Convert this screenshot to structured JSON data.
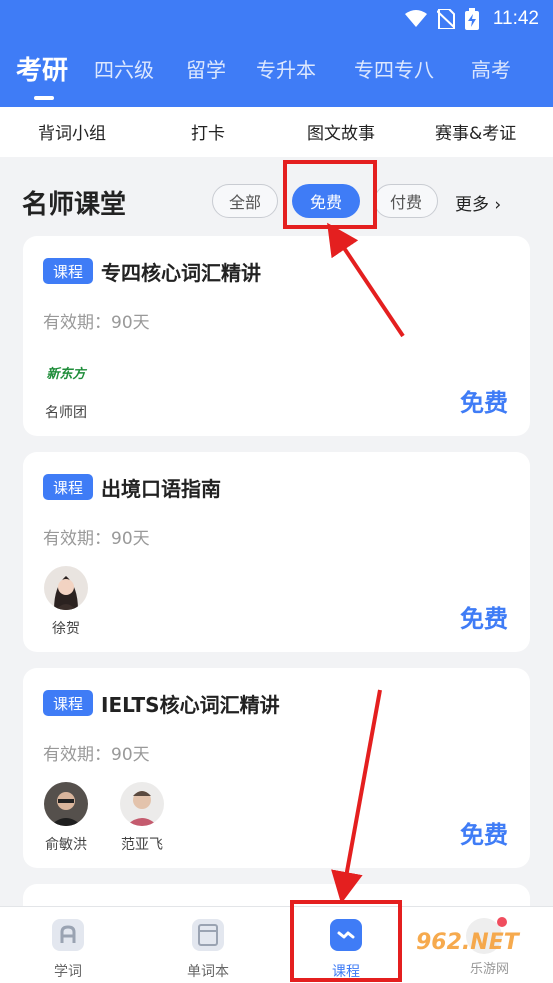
{
  "status_bar": {
    "time": "11:42",
    "icons": [
      "wifi-icon",
      "no-sim-icon",
      "battery-charging-icon"
    ]
  },
  "top_tabs": [
    {
      "label": "考研",
      "active": true
    },
    {
      "label": "四六级"
    },
    {
      "label": "留学"
    },
    {
      "label": "专升本"
    },
    {
      "label": "专四专八"
    },
    {
      "label": "高考"
    }
  ],
  "sub_nav": [
    "背词小组",
    "打卡",
    "图文故事",
    "赛事&考证"
  ],
  "section": {
    "title": "名师课堂",
    "filters": [
      {
        "label": "全部"
      },
      {
        "label": "免费",
        "active": true
      },
      {
        "label": "付费"
      }
    ],
    "more": "更多 ›"
  },
  "courses": [
    {
      "badge": "课程",
      "title": "专四核心词汇精讲",
      "validity": "有效期：90天",
      "price": "免费",
      "teachers": [
        {
          "name": "名师团",
          "logo_text": "新东方"
        }
      ]
    },
    {
      "badge": "课程",
      "title": "出境口语指南",
      "validity": "有效期：90天",
      "price": "免费",
      "teachers": [
        {
          "name": "徐贺"
        }
      ]
    },
    {
      "badge": "课程",
      "title": "IELTS核心词汇精讲",
      "validity": "有效期：90天",
      "price": "免费",
      "teachers": [
        {
          "name": "俞敏洪"
        },
        {
          "name": "范亚飞"
        }
      ]
    }
  ],
  "bottom_tabs": [
    {
      "label": "学词",
      "icon": "letter-a-icon"
    },
    {
      "label": "单词本",
      "icon": "notebook-icon"
    },
    {
      "label": "课程",
      "icon": "course-icon",
      "active": true
    }
  ],
  "watermark": {
    "brand": "962.NET",
    "sub": "乐游网"
  },
  "colors": {
    "primary": "#3f7cf6",
    "highlight": "#e41f1f",
    "badge_dot": "#f04d5e"
  }
}
